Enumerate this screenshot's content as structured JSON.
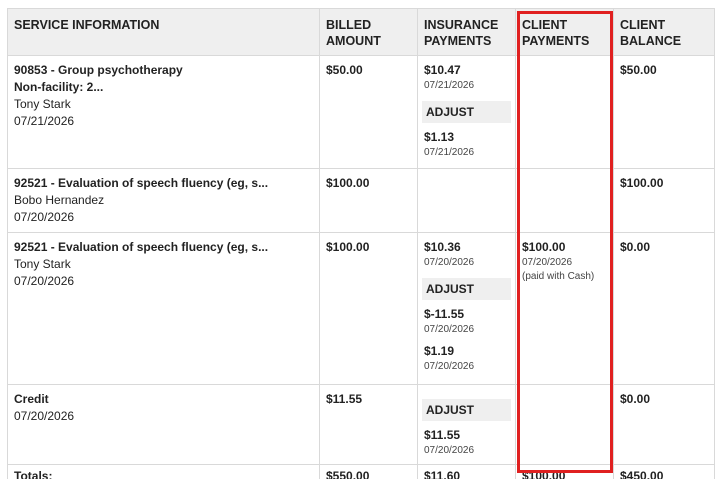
{
  "headers": {
    "service": "SERVICE INFORMATION",
    "billed": "BILLED AMOUNT",
    "insurance": "INSURANCE PAYMENTS",
    "client_payments": "CLIENT PAYMENTS",
    "client_balance": "CLIENT BALANCE"
  },
  "rows": [
    {
      "service_line1": "90853 - Group psychotherapy",
      "service_line2": "Non-facility: 2...",
      "person": "Tony Stark",
      "date": "07/21/2026",
      "billed": "$50.00",
      "ins_payment": "$10.47",
      "ins_payment_date": "07/21/2026",
      "adjust_label": "ADJUST",
      "adjust_amount": "$1.13",
      "adjust_date": "07/21/2026",
      "balance": "$50.00"
    },
    {
      "service_line1": "92521 - Evaluation of speech fluency (eg, s...",
      "person": "Bobo Hernandez",
      "date": "07/20/2026",
      "billed": "$100.00",
      "balance": "$100.00"
    },
    {
      "service_line1": "92521 - Evaluation of speech fluency (eg, s...",
      "person": "Tony Stark",
      "date": "07/20/2026",
      "billed": "$100.00",
      "ins_payment": "$10.36",
      "ins_payment_date": "07/20/2026",
      "adjust_label": "ADJUST",
      "adjust_amount1": "$-11.55",
      "adjust_date1": "07/20/2026",
      "adjust_amount2": "$1.19",
      "adjust_date2": "07/20/2026",
      "client_payment": "$100.00",
      "client_payment_date": "07/20/2026",
      "client_payment_note": "(paid with Cash)",
      "balance": "$0.00"
    },
    {
      "service_line1": "Credit",
      "date": "07/20/2026",
      "billed": "$11.55",
      "adjust_label": "ADJUST",
      "adjust_amount": "$11.55",
      "adjust_date": "07/20/2026",
      "balance": "$0.00"
    }
  ],
  "totals": {
    "label": "Totals:",
    "billed": "$550.00",
    "insurance": "$11.60",
    "client_payments": "$100.00",
    "client_balance": "$450.00"
  },
  "highlight_color": "#e02020"
}
